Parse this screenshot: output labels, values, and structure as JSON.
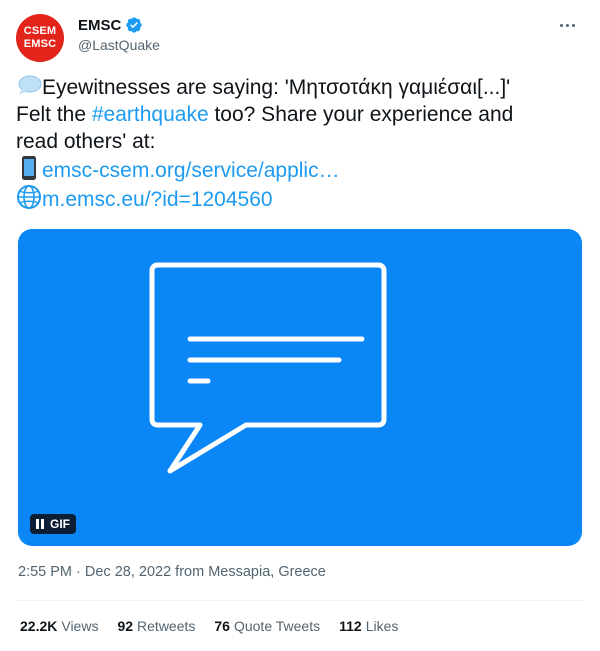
{
  "author": {
    "avatar_top": "CSEM",
    "avatar_bottom": "EMSC",
    "display_name": "EMSC",
    "handle": "@LastQuake"
  },
  "tweet": {
    "line1_text": "Eyewitnesses are saying: 'Μητσοτάκη γαμιέσαι[...]'",
    "line2_prefix": "Felt the ",
    "hashtag": "#earthquake",
    "line2_suffix": " too? Share your experience and",
    "line3_text": "read others' at:",
    "link1": "emsc-csem.org/service/applic…",
    "link2": "m.emsc.eu/?id=1204560"
  },
  "media": {
    "badge": "GIF",
    "background_color": "#0b86f7"
  },
  "meta": {
    "timestamp": "2:55 PM · Dec 28, 2022 from Messapia, Greece"
  },
  "stats": {
    "views_count": "22.2K",
    "views_label": "Views",
    "retweets_count": "92",
    "retweets_label": "Retweets",
    "quotes_count": "76",
    "quotes_label": "Quote Tweets",
    "likes_count": "112",
    "likes_label": "Likes"
  },
  "icons": {
    "verified": "verified-badge-icon",
    "more": "more-horizontal-icon",
    "speech": "speech-balloon-icon",
    "phone": "mobile-phone-icon",
    "globe": "globe-icon",
    "pause": "pause-icon"
  }
}
